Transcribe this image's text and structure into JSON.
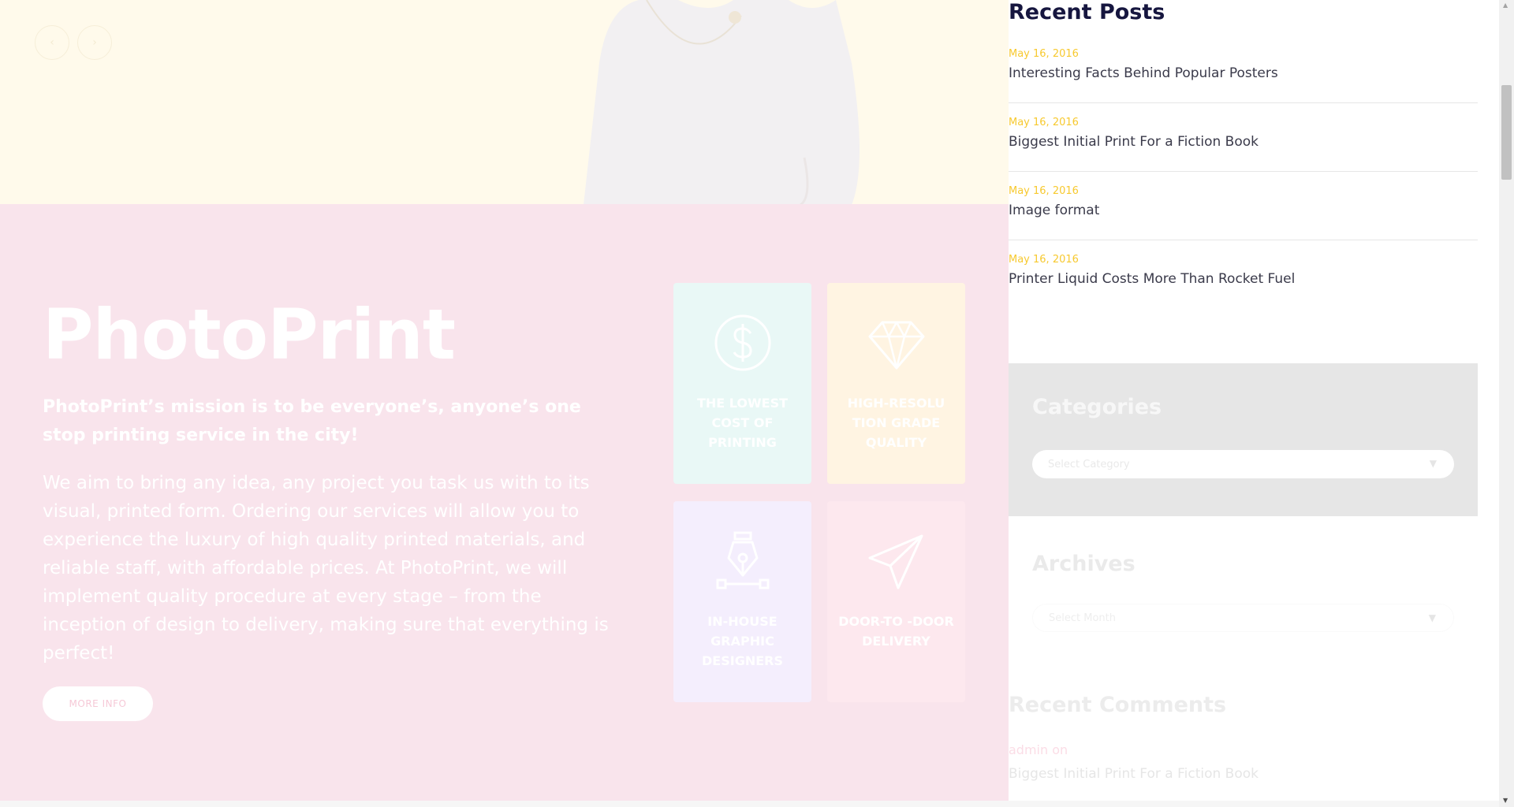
{
  "hero": {
    "slider_prev_glyph": "‹",
    "slider_next_glyph": "›"
  },
  "intro": {
    "title": "PhotoPrint",
    "lead": "PhotoPrint’s mission is to be everyone’s, anyone’s one stop printing service in the city!",
    "body": "We aim to bring any idea, any project you task us with to its visual, printed form. Ordering our services will allow you to experience the luxury of high quality printed materials, and reliable staff, with affordable prices. At PhotoPrint, we will implement quality procedure at every stage – from the inception of design to delivery, making sure that everything is perfect!",
    "button_label": "MORE INFO",
    "features": [
      {
        "label": "THE LOWEST COST OF PRINTING",
        "icon": "dollar-icon",
        "color": "#e9f8f6"
      },
      {
        "label": "HIGH-RESOLU TION GRADE QUALITY",
        "icon": "diamond-icon",
        "color": "#fff4e2"
      },
      {
        "label": "IN-HOUSE GRAPHIC DESIGNERS",
        "icon": "pen-tool-icon",
        "color": "#f4eefd"
      },
      {
        "label": "DOOR-TO -DOOR DELIVERY",
        "icon": "paper-plane-icon",
        "color": "#fde8ee"
      }
    ]
  },
  "sidebar": {
    "recent_posts": {
      "title": "Recent Posts",
      "items": [
        {
          "date": "May 16, 2016",
          "title": "Interesting Facts Behind Popular Posters"
        },
        {
          "date": "May 16, 2016",
          "title": "Biggest Initial Print For a Fiction Book"
        },
        {
          "date": "May 16, 2016",
          "title": "Image format"
        },
        {
          "date": "May 16, 2016",
          "title": "Printer Liquid Costs More Than Rocket Fuel"
        }
      ]
    },
    "categories": {
      "title": "Categories",
      "select_value": "Select Category"
    },
    "archives": {
      "title": "Archives",
      "select_value": "Select Month"
    },
    "recent_comments": {
      "title": "Recent Comments",
      "author_line": "admin on",
      "post_title": "Biggest Initial Print For a Fiction Book"
    }
  },
  "colors": {
    "accent_date": "#f7c92f",
    "intro_background": "#f9e4ec",
    "hero_background": "#fffaeb",
    "heading_dark": "#16163f"
  }
}
